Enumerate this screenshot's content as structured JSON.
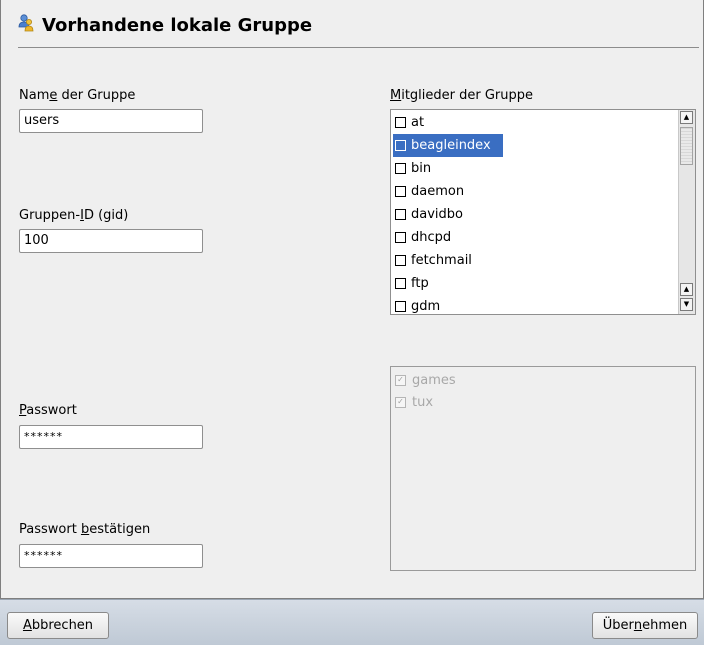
{
  "dialog": {
    "title": "Vorhandene lokale Gruppe",
    "title_icon": "group-icon"
  },
  "form": {
    "group_name": {
      "label_pre": "Nam",
      "label_mnemonic": "e",
      "label_post": " der Gruppe",
      "value": "users"
    },
    "group_id": {
      "label_pre": "Gruppen-",
      "label_mnemonic": "I",
      "label_post": "D (gid)",
      "value": "100"
    },
    "password": {
      "label_pre": "",
      "label_mnemonic": "P",
      "label_post": "asswort",
      "value": "******"
    },
    "password_confirm": {
      "label_pre": "Passwort ",
      "label_mnemonic": "b",
      "label_post": "estätigen",
      "value": "******"
    }
  },
  "members": {
    "label_pre": "",
    "label_mnemonic": "M",
    "label_post": "itglieder der Gruppe",
    "items": [
      "at",
      "beagleindex",
      "bin",
      "daemon",
      "davidbo",
      "dhcpd",
      "fetchmail",
      "ftp",
      "gdm"
    ],
    "selected_index": 1
  },
  "additional_members": {
    "items": [
      "games",
      "tux"
    ]
  },
  "footer": {
    "cancel_mnemonic": "A",
    "cancel_rest": "bbrechen",
    "apply_pre": "Über",
    "apply_mnemonic": "n",
    "apply_post": "ehmen"
  },
  "colors": {
    "selection": "#3a6ec2",
    "footer_bg": "#c8d1dc"
  }
}
